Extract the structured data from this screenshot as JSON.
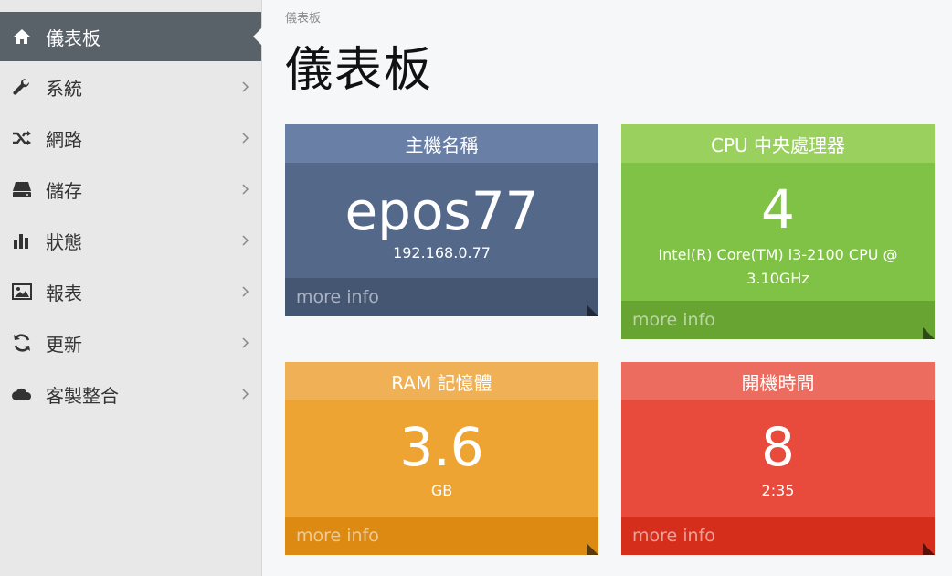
{
  "sidebar": {
    "items": [
      {
        "label": "儀表板",
        "icon": "home-icon",
        "active": true
      },
      {
        "label": "系統",
        "icon": "wrench-icon"
      },
      {
        "label": "網路",
        "icon": "shuffle-icon"
      },
      {
        "label": "儲存",
        "icon": "hdd-icon"
      },
      {
        "label": "狀態",
        "icon": "bar-chart-icon"
      },
      {
        "label": "報表",
        "icon": "picture-icon"
      },
      {
        "label": "更新",
        "icon": "refresh-icon"
      },
      {
        "label": "客製整合",
        "icon": "cloud-icon"
      }
    ]
  },
  "breadcrumb": "儀表板",
  "page_title": "儀表板",
  "cards": {
    "host": {
      "title": "主機名稱",
      "value": "epos77",
      "sub": "192.168.0.77",
      "more": "more info",
      "color": "#546889"
    },
    "cpu": {
      "title": "CPU 中央處理器",
      "value": "4",
      "sub": "Intel(R) Core(TM) i3-2100 CPU @ 3.10GHz",
      "more": "more info",
      "color": "#7fc246"
    },
    "ram": {
      "title": "RAM 記憶體",
      "value": "3.6",
      "sub": "GB",
      "more": "more info",
      "color": "#eea433"
    },
    "uptime": {
      "title": "開機時間",
      "value": "8",
      "sub": "2:35",
      "more": "more info",
      "color": "#e84a3c"
    }
  }
}
